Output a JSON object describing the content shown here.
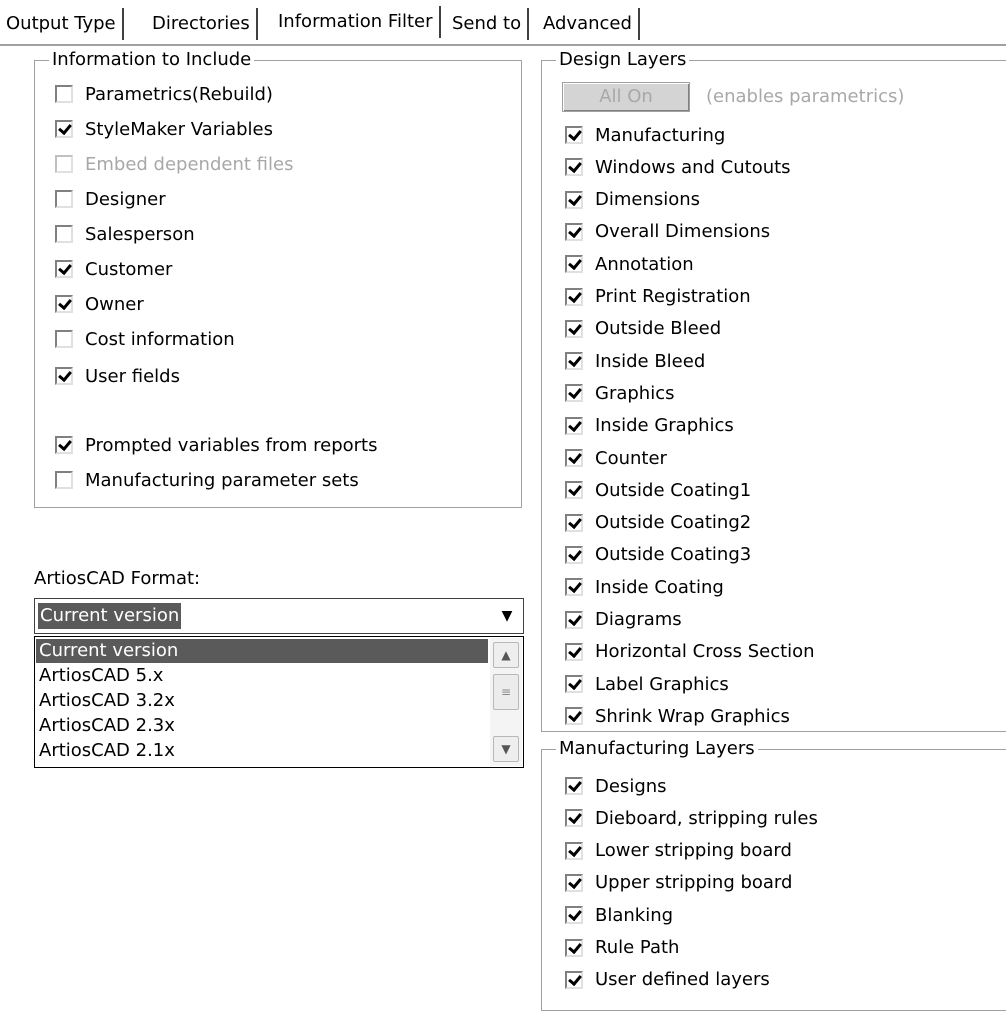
{
  "tabs": [
    {
      "label": "Output Type"
    },
    {
      "label": "Directories"
    },
    {
      "label": "Information Filter"
    },
    {
      "label": "Send to"
    },
    {
      "label": "Advanced"
    }
  ],
  "info_group": {
    "title": "Information to Include",
    "items": [
      {
        "label": "Parametrics(Rebuild)",
        "checked": false,
        "disabled": false
      },
      {
        "label": "StyleMaker Variables",
        "checked": true,
        "disabled": false
      },
      {
        "label": "Embed dependent files",
        "checked": false,
        "disabled": true
      },
      {
        "label": "Designer",
        "checked": false,
        "disabled": false
      },
      {
        "label": "Salesperson",
        "checked": false,
        "disabled": false
      },
      {
        "label": "Customer",
        "checked": true,
        "disabled": false
      },
      {
        "label": "Owner",
        "checked": true,
        "disabled": false
      },
      {
        "label": "Cost information",
        "checked": false,
        "disabled": false
      },
      {
        "label": "User fields",
        "checked": true,
        "disabled": false
      },
      {
        "label": "Prompted variables from reports",
        "checked": true,
        "disabled": false
      },
      {
        "label": "Manufacturing parameter sets",
        "checked": false,
        "disabled": false
      }
    ]
  },
  "format": {
    "label": "ArtiosCAD Format:",
    "selected": "Current version",
    "options": [
      "Current version",
      "ArtiosCAD 5.x",
      "ArtiosCAD 3.2x",
      "ArtiosCAD 2.3x",
      "ArtiosCAD 2.1x"
    ]
  },
  "design_group": {
    "title": "Design Layers",
    "all_on_label": "All On",
    "hint": "(enables parametrics)",
    "items": [
      {
        "label": "Manufacturing",
        "checked": true
      },
      {
        "label": "Windows and Cutouts",
        "checked": true
      },
      {
        "label": "Dimensions",
        "checked": true
      },
      {
        "label": "Overall Dimensions",
        "checked": true
      },
      {
        "label": "Annotation",
        "checked": true
      },
      {
        "label": "Print Registration",
        "checked": true
      },
      {
        "label": "Outside Bleed",
        "checked": true
      },
      {
        "label": "Inside Bleed",
        "checked": true
      },
      {
        "label": "Graphics",
        "checked": true
      },
      {
        "label": "Inside Graphics",
        "checked": true
      },
      {
        "label": "Counter",
        "checked": true
      },
      {
        "label": "Outside Coating1",
        "checked": true
      },
      {
        "label": "Outside Coating2",
        "checked": true
      },
      {
        "label": "Outside Coating3",
        "checked": true
      },
      {
        "label": "Inside Coating",
        "checked": true
      },
      {
        "label": "Diagrams",
        "checked": true
      },
      {
        "label": "Horizontal Cross Section",
        "checked": true
      },
      {
        "label": "Label Graphics",
        "checked": true
      },
      {
        "label": "Shrink Wrap Graphics",
        "checked": true
      }
    ]
  },
  "mfg_group": {
    "title": "Manufacturing Layers",
    "items": [
      {
        "label": "Designs",
        "checked": true
      },
      {
        "label": "Dieboard, stripping rules",
        "checked": true
      },
      {
        "label": "Lower stripping board",
        "checked": true
      },
      {
        "label": "Upper stripping board",
        "checked": true
      },
      {
        "label": "Blanking",
        "checked": true
      },
      {
        "label": "Rule Path",
        "checked": true
      },
      {
        "label": "User defined layers",
        "checked": true
      }
    ]
  }
}
